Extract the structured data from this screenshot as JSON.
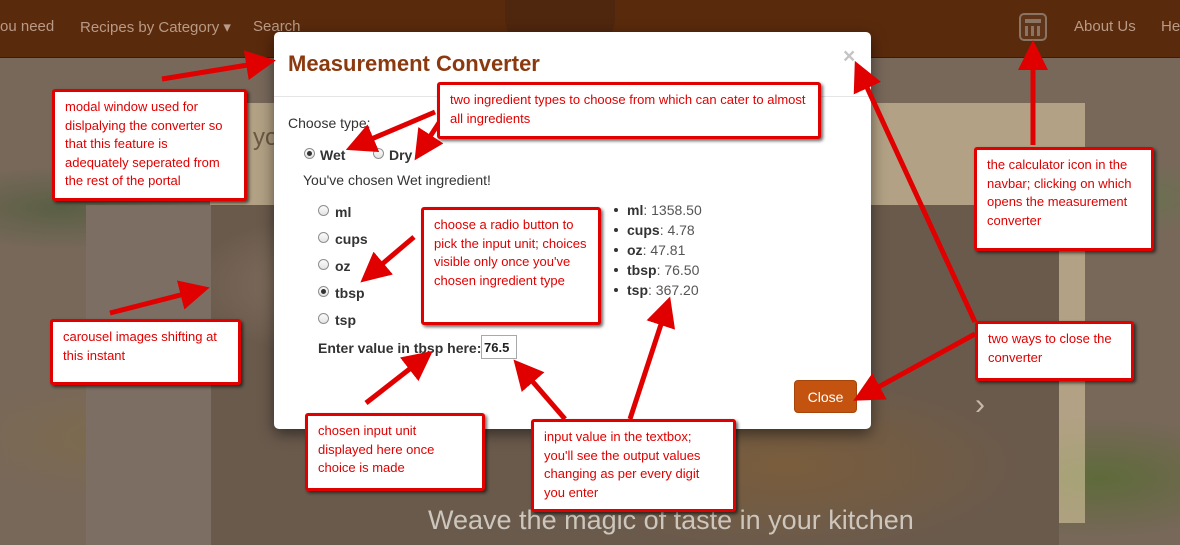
{
  "navbar": {
    "left_links": [
      "ou need",
      "Recipes by Category ▾",
      "Search"
    ],
    "right_links": [
      "About Us",
      "He"
    ],
    "calculator_icon": "calculator-icon"
  },
  "page": {
    "panel_text": "yo",
    "caption": "Weave the magic of taste in your kitchen",
    "carousel_next": "›"
  },
  "modal": {
    "title": "Measurement Converter",
    "close_x": "×",
    "choose_type_label": "Choose type:",
    "types": [
      {
        "label": "Wet",
        "checked": true
      },
      {
        "label": "Dry",
        "checked": false
      }
    ],
    "chosen_text": "You've chosen Wet ingredient!",
    "units": [
      {
        "label": "ml",
        "checked": false
      },
      {
        "label": "cups",
        "checked": false
      },
      {
        "label": "oz",
        "checked": false
      },
      {
        "label": "tbsp",
        "checked": true
      },
      {
        "label": "tsp",
        "checked": false
      }
    ],
    "input_label": "Enter value in tbsp here:",
    "input_value": "76.5",
    "outputs": [
      {
        "unit": "ml",
        "value": ": 1358.50"
      },
      {
        "unit": "cups",
        "value": ": 4.78"
      },
      {
        "unit": "oz",
        "value": ": 47.81"
      },
      {
        "unit": "tbsp",
        "value": ": 76.50"
      },
      {
        "unit": "tsp",
        "value": ": 367.20"
      }
    ],
    "close_button": "Close"
  },
  "annotations": {
    "modal_window": "modal window used for dislpalying the converter so that this feature is adequately seperated from the rest of the portal",
    "ingredient_types": "two ingredient types to choose from which can cater to almost all ingredients",
    "calculator_icon": "the calculator icon in the navbar; clicking on which opens the measurement converter",
    "radio_buttons": "choose a radio button to pick the input unit; choices visible only once you've chosen ingredient type",
    "carousel": "carousel images shifting at this instant",
    "close_ways": "two ways to close the converter",
    "chosen_unit": "chosen input unit displayed here once choice is made",
    "input_value": "input value in the textbox; you'll see the output values changing as per every digit you enter"
  },
  "colors": {
    "navbar": "#5a2a0c",
    "modal_title": "#8b3a0f",
    "close_button": "#c3530f",
    "annotation": "#e00000"
  }
}
